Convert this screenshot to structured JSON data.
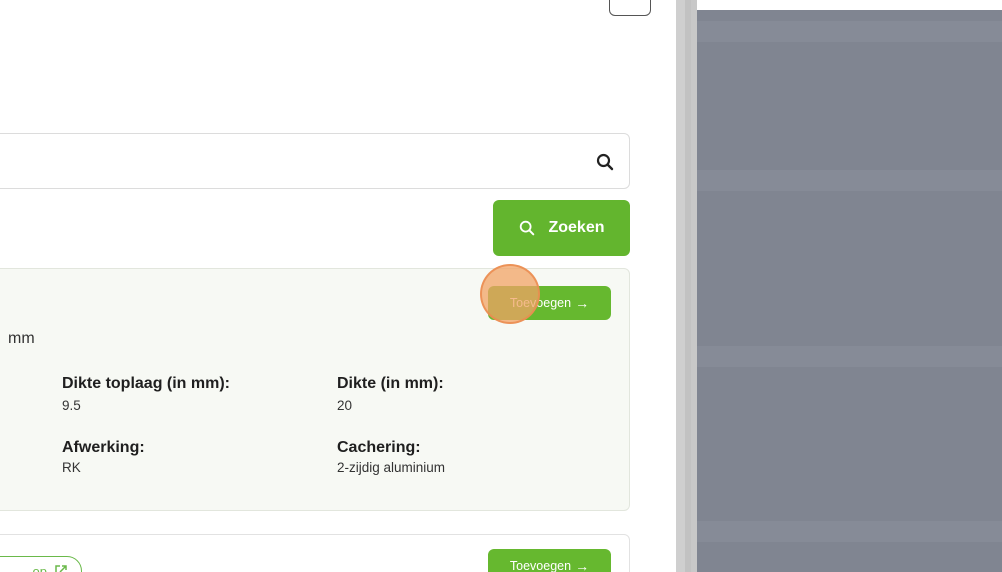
{
  "search": {
    "value": "",
    "placeholder": "",
    "icon": "search-icon"
  },
  "search_button": {
    "label": "Zoeken",
    "icon": "search-icon"
  },
  "product_card": {
    "add_label": "Toevoegen",
    "add_arrow": "→",
    "dimension_fragment": "mm",
    "specs": [
      {
        "label": "Dikte toplaag (in mm):",
        "value": "9.5"
      },
      {
        "label": "Dikte (in mm):",
        "value": "20"
      },
      {
        "label": "Afwerking:",
        "value": "RK"
      },
      {
        "label": "Cachering:",
        "value": "2-zijdig aluminium"
      }
    ]
  },
  "product_card_2": {
    "link_fragment": "op",
    "link_icon": "external-link-icon",
    "add_label": "Toevoegen",
    "add_arrow": "→"
  },
  "colors": {
    "accent_green": "#63b52e",
    "overlay_gray": "#808591",
    "click_marker": "#f2a366"
  }
}
